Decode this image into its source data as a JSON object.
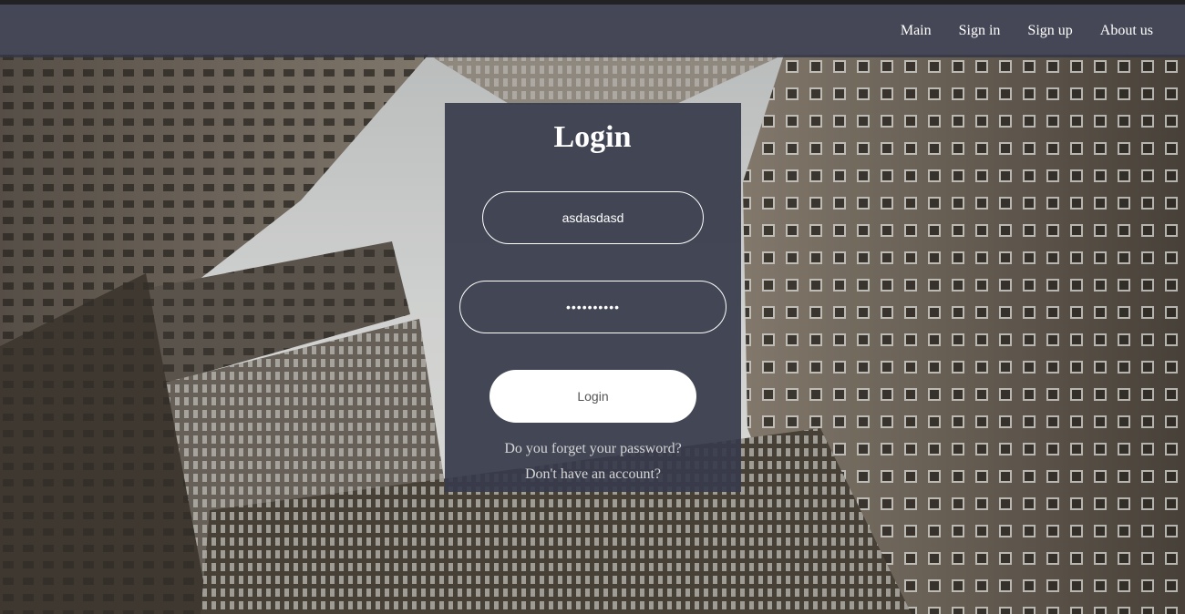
{
  "nav": {
    "items": [
      {
        "label": "Main"
      },
      {
        "label": "Sign in"
      },
      {
        "label": "Sign up"
      },
      {
        "label": "About us"
      }
    ]
  },
  "background": {
    "icon": "city-skyscrapers-photo",
    "sky_color": "#dfe3e6",
    "building_color": "#3a3531"
  },
  "login_form": {
    "title": "Login",
    "username_value": "asdasdasd",
    "password_value": "asdasdasda",
    "submit_label": "Login",
    "forgot_link": "Do you forget your password?",
    "signup_link": "Don't have an account?"
  },
  "colors": {
    "navbar": "#343748",
    "card": "#383b4b",
    "button": "#ffffff",
    "button_text": "#555555"
  }
}
